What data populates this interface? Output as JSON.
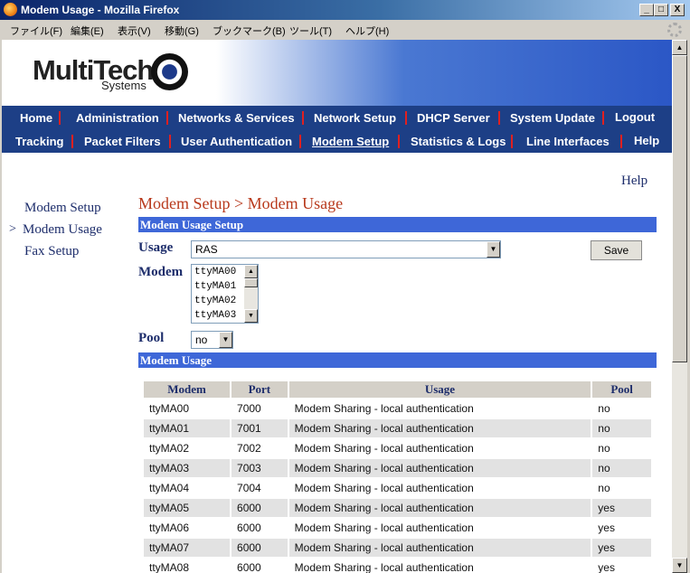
{
  "window": {
    "title": "Modem Usage - Mozilla Firefox",
    "buttons": {
      "minimize": "_",
      "maximize": "□",
      "close": "X"
    }
  },
  "menubar": [
    "ファイル(F)",
    "編集(E)",
    "表示(V)",
    "移動(G)",
    "ブックマーク(B)",
    "ツール(T)",
    "ヘルプ(H)"
  ],
  "logo": {
    "name": "MultiTech",
    "sub": "Systems"
  },
  "nav": {
    "row1": [
      "Home",
      "Administration",
      "Networks & Services",
      "Network Setup",
      "DHCP Server",
      "System Update",
      "Logout"
    ],
    "row2": [
      "Tracking",
      "Packet Filters",
      "User Authentication",
      "Modem Setup",
      "Statistics & Logs",
      "Line Interfaces",
      "Help"
    ]
  },
  "help_link": "Help",
  "sidebar": [
    {
      "label": "Modem Setup"
    },
    {
      "label": "Modem Usage"
    },
    {
      "label": "Fax Setup"
    }
  ],
  "sidebar_current_marker": ">",
  "page_title": "Modem Setup > Modem Usage",
  "setup": {
    "heading": "Modem Usage Setup",
    "usage_label": "Usage",
    "usage_value": "RAS",
    "save_label": "Save",
    "modem_label": "Modem",
    "modem_options": [
      "ttyMA00",
      "ttyMA01",
      "ttyMA02",
      "ttyMA03"
    ],
    "pool_label": "Pool",
    "pool_value": "no"
  },
  "usage_table": {
    "heading": "Modem Usage",
    "columns": [
      "Modem",
      "Port",
      "Usage",
      "Pool"
    ],
    "rows": [
      [
        "ttyMA00",
        "7000",
        "Modem Sharing - local authentication",
        "no"
      ],
      [
        "ttyMA01",
        "7001",
        "Modem Sharing - local authentication",
        "no"
      ],
      [
        "ttyMA02",
        "7002",
        "Modem Sharing - local authentication",
        "no"
      ],
      [
        "ttyMA03",
        "7003",
        "Modem Sharing - local authentication",
        "no"
      ],
      [
        "ttyMA04",
        "7004",
        "Modem Sharing - local authentication",
        "no"
      ],
      [
        "ttyMA05",
        "6000",
        "Modem Sharing - local authentication",
        "yes"
      ],
      [
        "ttyMA06",
        "6000",
        "Modem Sharing - local authentication",
        "yes"
      ],
      [
        "ttyMA07",
        "6000",
        "Modem Sharing - local authentication",
        "yes"
      ],
      [
        "ttyMA08",
        "6000",
        "Modem Sharing - local authentication",
        "yes"
      ]
    ]
  },
  "colors": {
    "nav_bg": "#1d3f86",
    "section_bar": "#3e67d8",
    "title_red": "#b8391c",
    "nav_separator": "#e02020"
  }
}
